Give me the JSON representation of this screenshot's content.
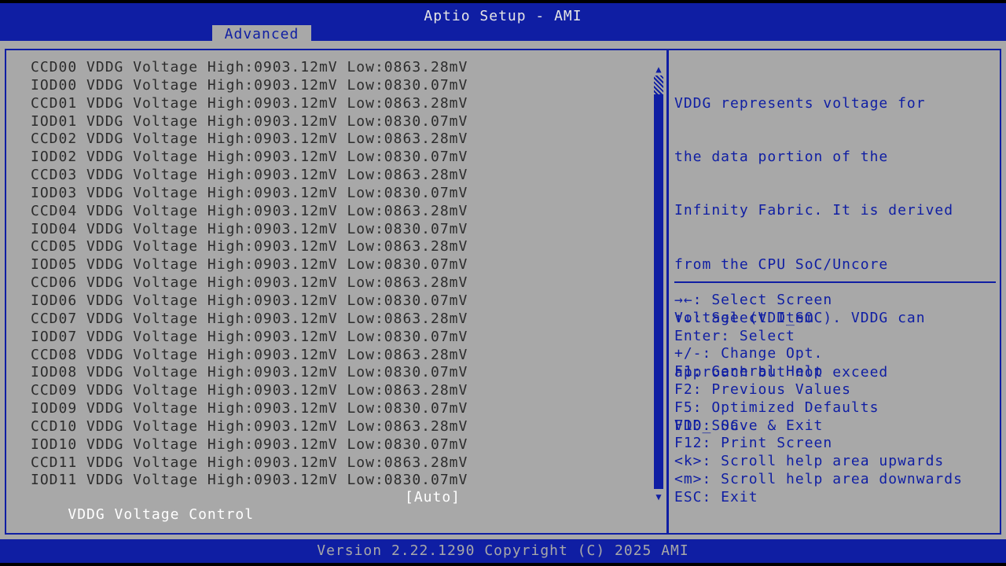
{
  "header": {
    "title": "Aptio Setup - AMI",
    "tab": "Advanced"
  },
  "voltage_list": [
    "CCD00 VDDG Voltage High:0903.12mV Low:0863.28mV",
    "IOD00 VDDG Voltage High:0903.12mV Low:0830.07mV",
    "CCD01 VDDG Voltage High:0903.12mV Low:0863.28mV",
    "IOD01 VDDG Voltage High:0903.12mV Low:0830.07mV",
    "CCD02 VDDG Voltage High:0903.12mV Low:0863.28mV",
    "IOD02 VDDG Voltage High:0903.12mV Low:0830.07mV",
    "CCD03 VDDG Voltage High:0903.12mV Low:0863.28mV",
    "IOD03 VDDG Voltage High:0903.12mV Low:0830.07mV",
    "CCD04 VDDG Voltage High:0903.12mV Low:0863.28mV",
    "IOD04 VDDG Voltage High:0903.12mV Low:0830.07mV",
    "CCD05 VDDG Voltage High:0903.12mV Low:0863.28mV",
    "IOD05 VDDG Voltage High:0903.12mV Low:0830.07mV",
    "CCD06 VDDG Voltage High:0903.12mV Low:0863.28mV",
    "IOD06 VDDG Voltage High:0903.12mV Low:0830.07mV",
    "CCD07 VDDG Voltage High:0903.12mV Low:0863.28mV",
    "IOD07 VDDG Voltage High:0903.12mV Low:0830.07mV",
    "CCD08 VDDG Voltage High:0903.12mV Low:0863.28mV",
    "IOD08 VDDG Voltage High:0903.12mV Low:0830.07mV",
    "CCD09 VDDG Voltage High:0903.12mV Low:0863.28mV",
    "IOD09 VDDG Voltage High:0903.12mV Low:0830.07mV",
    "CCD10 VDDG Voltage High:0903.12mV Low:0863.28mV",
    "IOD10 VDDG Voltage High:0903.12mV Low:0830.07mV",
    "CCD11 VDDG Voltage High:0903.12mV Low:0863.28mV",
    "IOD11 VDDG Voltage High:0903.12mV Low:0830.07mV"
  ],
  "control": {
    "label": "VDDG Voltage Control",
    "value": "[Auto]"
  },
  "scroll": {
    "up_arrow": "▲",
    "down_arrow": "▼"
  },
  "help": {
    "lines": [
      "VDDG represents voltage for",
      "the data portion of the",
      "Infinity Fabric. It is derived",
      "from the CPU SoC/Uncore",
      "Voltage (VDD_SOC). VDDG can",
      "approach but not exceed",
      "VDD_SOC."
    ]
  },
  "keys": [
    "→←: Select Screen",
    "↑↓: Select Item",
    "Enter: Select",
    "+/-: Change Opt.",
    "F1: General Help",
    "F2: Previous Values",
    "F5: Optimized Defaults",
    "F10: Save & Exit",
    "F12: Print Screen",
    "<k>: Scroll help area upwards",
    "<m>: Scroll help area downwards",
    "ESC: Exit"
  ],
  "footer": {
    "version": "Version 2.22.1290 Copyright (C) 2025 AMI"
  },
  "colors": {
    "blue": "#0f1ea3",
    "gray": "#a8a8a8",
    "text": "#2c2c2c",
    "white": "#ffffff"
  }
}
